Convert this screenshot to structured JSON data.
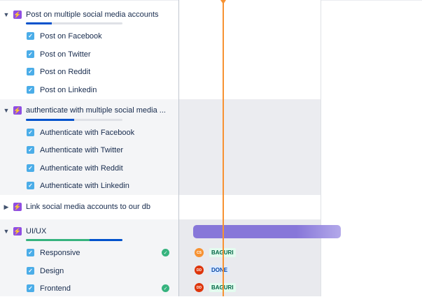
{
  "colors": {
    "epic": "#904ee2",
    "task": "#4bade8",
    "done": "#36b37e",
    "in_progress": "#0052cc",
    "today_marker": "#f79232",
    "epic_bar": "#8777d9"
  },
  "epics": [
    {
      "title": "Post on multiple social media accounts",
      "icon": "epic-lightning-icon",
      "expanded": true,
      "progress": {
        "done": 0,
        "in_progress": 0.27
      },
      "tasks": [
        {
          "title": "Post on Facebook",
          "icon": "task-checkbox-icon"
        },
        {
          "title": "Post on Twitter",
          "icon": "task-checkbox-icon"
        },
        {
          "title": "Post on Reddit",
          "icon": "task-checkbox-icon"
        },
        {
          "title": "Post on Linkedin",
          "icon": "task-checkbox-icon"
        }
      ]
    },
    {
      "title": "authenticate with multiple social media ...",
      "icon": "epic-lightning-icon",
      "expanded": true,
      "progress": {
        "done": 0,
        "in_progress": 0.5
      },
      "tasks": [
        {
          "title": "Authenticate with Facebook",
          "icon": "task-checkbox-icon"
        },
        {
          "title": "Authenticate with Twitter",
          "icon": "task-checkbox-icon"
        },
        {
          "title": "Authenticate with Reddit",
          "icon": "task-checkbox-icon"
        },
        {
          "title": "Authenticate with Linkedin",
          "icon": "task-checkbox-icon"
        }
      ]
    },
    {
      "title": "Link social media accounts to our db",
      "icon": "epic-lightning-icon",
      "expanded": false,
      "tasks": []
    },
    {
      "title": "UI/UX",
      "icon": "epic-lightning-icon",
      "expanded": true,
      "progress": {
        "done": 0.66,
        "in_progress": 0.34
      },
      "tasks": [
        {
          "title": "Responsive",
          "icon": "task-checkbox-icon",
          "done": true,
          "assignee": "CS",
          "avatar_color": "#f79232",
          "status": "BAGURI",
          "status_color": "green"
        },
        {
          "title": "Design",
          "icon": "task-checkbox-icon",
          "done": false,
          "assignee": "DD",
          "avatar_color": "#de350b",
          "status": "DONE",
          "status_color": "blue"
        },
        {
          "title": "Frontend",
          "icon": "task-checkbox-icon",
          "done": true,
          "assignee": "DD",
          "avatar_color": "#de350b",
          "status": "BAGURI",
          "status_color": "green"
        }
      ]
    }
  ]
}
